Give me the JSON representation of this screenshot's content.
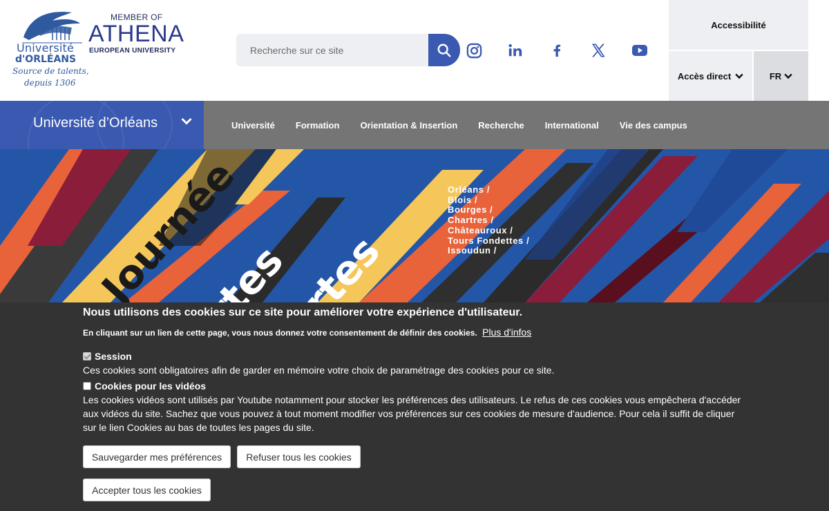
{
  "header": {
    "logo_uo": {
      "line1": "Université",
      "line2": "d'ORLÉANS",
      "tagline1": "Source de talents,",
      "tagline2": "depuis 1306"
    },
    "logo_athena": {
      "member": "MEMBER OF",
      "name": "ATHENA",
      "sub": "EUROPEAN UNIVERSITY"
    },
    "search": {
      "placeholder": "Recherche sur ce site",
      "icon": "search-icon"
    },
    "social": [
      "instagram-icon",
      "linkedin-icon",
      "facebook-icon",
      "x-icon",
      "youtube-icon"
    ],
    "accessibility_label": "Accessibilité",
    "acces_direct_label": "Accès direct",
    "language_label": "FR"
  },
  "nav": {
    "brand": "Université d’Orléans",
    "items": [
      "Université",
      "Formation",
      "Orientation & Insertion",
      "Recherche",
      "International",
      "Vie des campus"
    ]
  },
  "hero": {
    "cities": [
      "Orléans /",
      "Blois /",
      "Bourges /",
      "Chartres /",
      "Châteauroux /",
      "Tours Fondettes /",
      "Issoudun /"
    ],
    "headline_word1": "Journée",
    "headline_word2": "ortes",
    "headline_word3": "ertes",
    "colors": {
      "blue": "#2456a8",
      "orange": "#e8623a",
      "yellow": "#f5c75a",
      "dark": "#3a3a3a",
      "maroon": "#8a1d3a"
    }
  },
  "cookie": {
    "title": "Nous utilisons des cookies sur ce site pour améliorer votre expérience d'utilisateur.",
    "consent_text": "En cliquant sur un lien de cette page, vous nous donnez votre consentement de définir des cookies.",
    "more_link": "Plus d'infos",
    "session_label": "Session",
    "session_desc": "Ces cookies sont obligatoires afin de garder en mémoire votre choix de paramétrage des cookies pour ce site.",
    "videos_label": "Cookies pour les vidéos",
    "videos_desc": "Les cookies vidéos sont utilisés par Youtube notamment pour stocker les préférences des utilisateurs. Le refus de ces cookies vous empêchera d'accéder aux vidéos du site. Sachez que vous pouvez à tout moment modifier vos préférences sur ces cookies de mesure d'audience. Pour cela il suffit de cliquer sur le lien Cookies au bas de toutes les pages du site.",
    "save_button": "Sauvegarder mes préférences",
    "refuse_button": "Refuser tous les cookies",
    "accept_button": "Accepter tous les cookies"
  }
}
